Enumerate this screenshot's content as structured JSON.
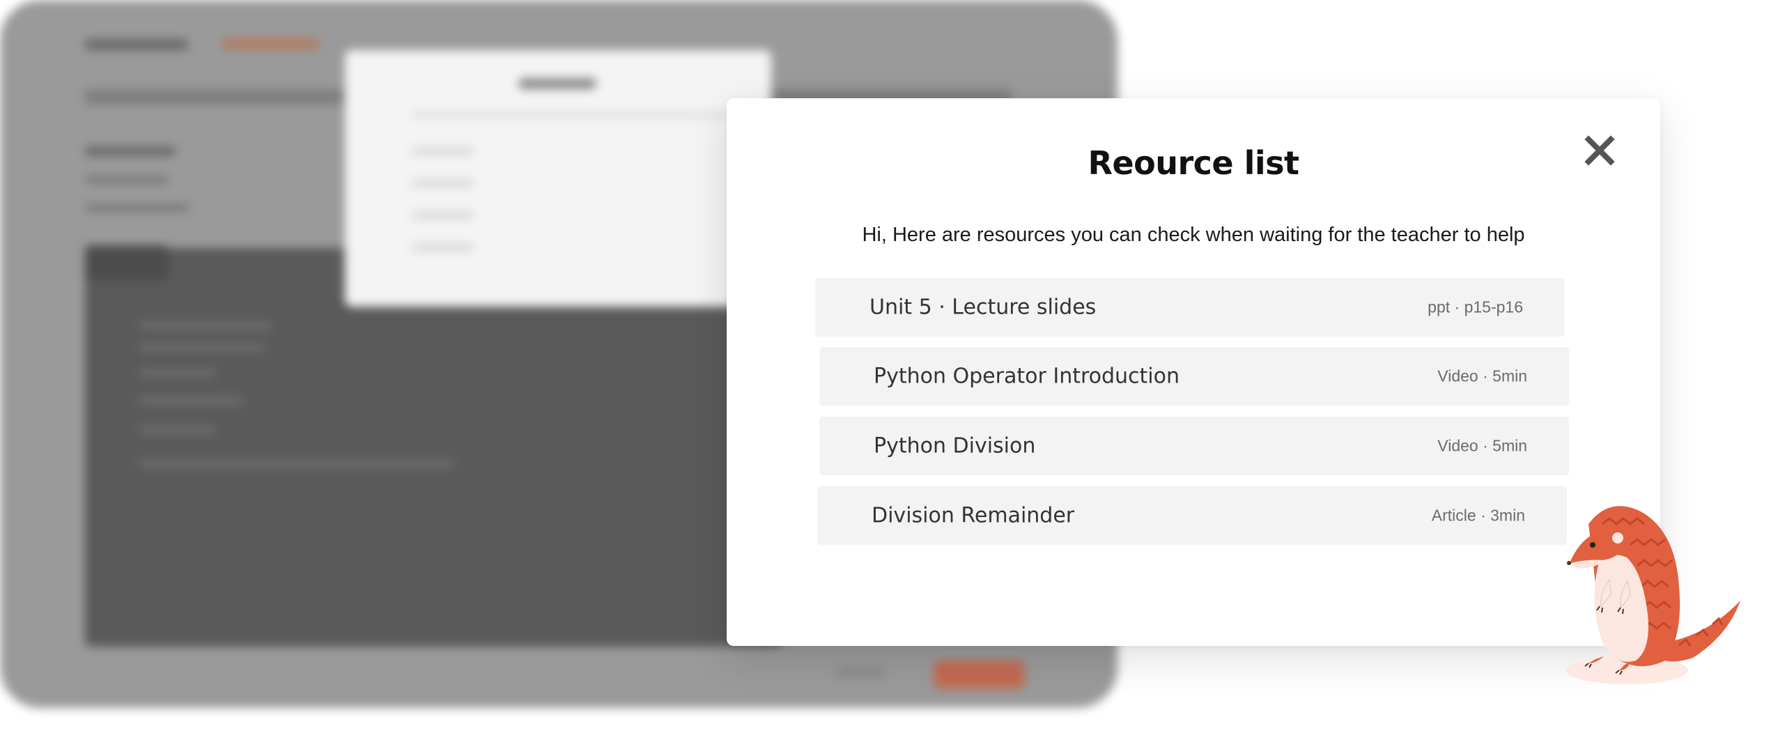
{
  "modal": {
    "title": "Reource list",
    "subtitle": "Hi, Here are resources you can check when waiting for the teacher to help",
    "close_icon": "close-icon"
  },
  "resources": [
    {
      "title": "Unit 5 · Lecture slides",
      "meta": "ppt · p15-p16"
    },
    {
      "title": "Python Operator Introduction",
      "meta": "Video · 5min"
    },
    {
      "title": "Python Division",
      "meta": "Video · 5min"
    },
    {
      "title": "Division Remainder",
      "meta": "Article · 3min"
    }
  ],
  "mascot": {
    "icon": "pangolin-mascot-icon"
  },
  "colors": {
    "background_overlay": "#9a9a9a",
    "modal_bg": "#ffffff",
    "item_bg": "#f3f3f3",
    "mascot_accent": "#e0603f"
  }
}
